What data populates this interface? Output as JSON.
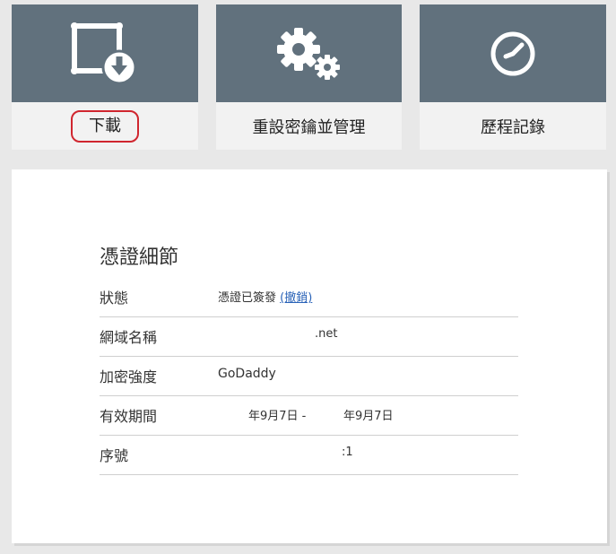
{
  "tiles": [
    {
      "label": "下載",
      "icon": "certificate-download-icon"
    },
    {
      "label": "重設密鑰並管理",
      "icon": "gears-icon"
    },
    {
      "label": "歷程記錄",
      "icon": "clock-icon"
    }
  ],
  "details": {
    "title": "憑證細節",
    "status": {
      "label": "狀態",
      "value": "憑證已簽發",
      "link": "(撤銷)"
    },
    "domain": {
      "label": "網域名稱",
      "value": ".net"
    },
    "encryption": {
      "label": "加密強度",
      "value": "GoDaddy"
    },
    "validity": {
      "label": "有效期間",
      "start": "年9月7日 -",
      "end": "年9月7日"
    },
    "serial": {
      "label": "序號",
      "value": ":1"
    }
  },
  "colors": {
    "tile_bg": "#61717d",
    "highlight_circle": "#d0262f",
    "link": "#2a63b8"
  }
}
